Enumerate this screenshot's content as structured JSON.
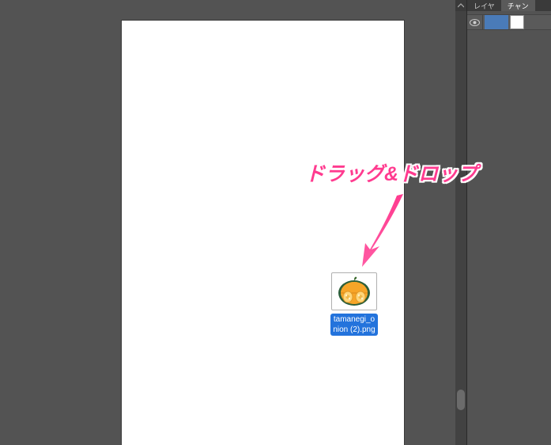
{
  "panel": {
    "tabs": [
      {
        "label": "レイヤ"
      },
      {
        "label": "チャン"
      }
    ]
  },
  "dragged_file": {
    "filename": "tamanegi_onion (2).png"
  },
  "annotation": {
    "text": "ドラッグ&ドロップ"
  },
  "colors": {
    "accent_pink": "#ff3b8f",
    "selection_blue": "#2373dc",
    "layer_highlight": "#4a7bb8"
  }
}
